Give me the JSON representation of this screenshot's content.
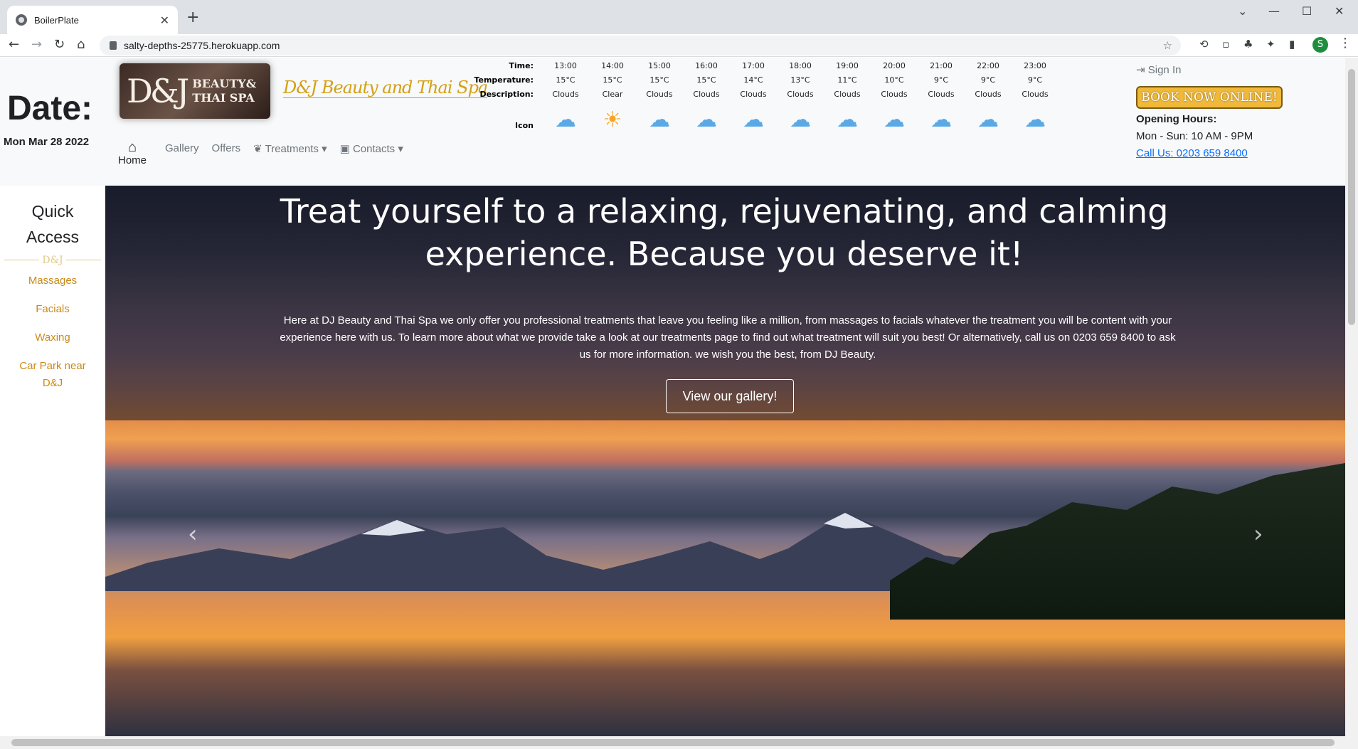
{
  "browser": {
    "tab_title": "BoilerPlate",
    "url": "salty-depths-25775.herokuapp.com",
    "profile_initial": "S"
  },
  "header": {
    "date_heading": "Date:",
    "date_value": "Mon Mar 28 2022",
    "logo_dj": "D&J",
    "logo_text_1": "BEAUTY&",
    "logo_text_2": "THAI SPA",
    "script_title": "D&J Beauty and Thai Spa",
    "nav": {
      "home": "Home",
      "gallery": "Gallery",
      "offers": "Offers",
      "treatments": "Treatments",
      "contacts": "Contacts"
    },
    "sign_in": "Sign In",
    "book_now": "BOOK NOW ONLINE!",
    "opening_hours_heading": "Opening Hours:",
    "opening_hours": "Mon - Sun: 10 AM - 9PM",
    "call_us": "Call Us: 0203 659 8400"
  },
  "weather": {
    "labels": {
      "time": "Time:",
      "temperature": "Temperature:",
      "description": "Description:",
      "icon": "Icon"
    },
    "hours": [
      {
        "time": "13:00",
        "temp": "15°C",
        "desc": "Clouds",
        "icon": "cloud-icon"
      },
      {
        "time": "14:00",
        "temp": "15°C",
        "desc": "Clear",
        "icon": "sun-icon"
      },
      {
        "time": "15:00",
        "temp": "15°C",
        "desc": "Clouds",
        "icon": "cloud-icon"
      },
      {
        "time": "16:00",
        "temp": "15°C",
        "desc": "Clouds",
        "icon": "cloud-icon"
      },
      {
        "time": "17:00",
        "temp": "14°C",
        "desc": "Clouds",
        "icon": "cloud-icon"
      },
      {
        "time": "18:00",
        "temp": "13°C",
        "desc": "Clouds",
        "icon": "cloud-icon"
      },
      {
        "time": "19:00",
        "temp": "11°C",
        "desc": "Clouds",
        "icon": "cloud-icon"
      },
      {
        "time": "20:00",
        "temp": "10°C",
        "desc": "Clouds",
        "icon": "cloud-icon"
      },
      {
        "time": "21:00",
        "temp": "9°C",
        "desc": "Clouds",
        "icon": "cloud-icon"
      },
      {
        "time": "22:00",
        "temp": "9°C",
        "desc": "Clouds",
        "icon": "cloud-icon"
      },
      {
        "time": "23:00",
        "temp": "9°C",
        "desc": "Clouds",
        "icon": "cloud-icon"
      }
    ]
  },
  "quick_access": {
    "title_1": "Quick",
    "title_2": "Access",
    "divider": "D&J",
    "links": [
      "Massages",
      "Facials",
      "Waxing",
      "Car Park near D&J"
    ]
  },
  "hero": {
    "headline": "Treat yourself to a relaxing, rejuvenating, and calming experience. Because you deserve it!",
    "paragraph": "Here at DJ Beauty and Thai Spa we only offer you professional treatments that leave you feeling like a million, from massages to facials whatever the treatment you will be content with your experience here with us. To learn more about what we provide take a look at our treatments page to find out what treatment will suit you best! Or alternatively, call us on 0203 659 8400 to ask us for more information. we wish you the best, from DJ Beauty.",
    "gallery_button": "View our gallery!"
  },
  "colors": {
    "accent_gold": "#c98a1a",
    "book_now_bg": "#f0b93a",
    "link_blue": "#0d6efd",
    "cloud_icon": "#5aa9e6",
    "sun_icon": "#f5a623"
  }
}
